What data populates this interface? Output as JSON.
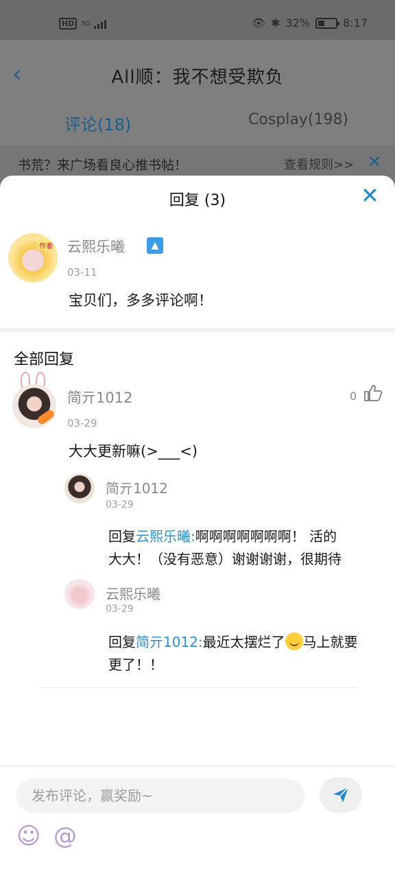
{
  "status_bar": {
    "hd": "HD",
    "network": "5G",
    "battery_percent": "32%",
    "time": "8:17"
  },
  "header": {
    "back_icon": "chevron-left-icon",
    "title": "All顺：我不想受欺负"
  },
  "tabs": [
    {
      "label": "评论(18)",
      "active": true
    },
    {
      "label": "Cosplay(198)",
      "active": false
    }
  ],
  "notice": {
    "text": "书荒？来广场看良心推书帖！",
    "link": "查看规则>>",
    "close_icon": "close-icon"
  },
  "sheet": {
    "title": "回复 (3)",
    "close_icon": "close-icon",
    "main_comment": {
      "author": "云熙乐曦",
      "author_badge": "作者",
      "date": "03-11",
      "text": "宝贝们，多多评论啊！",
      "pin_icon": "pin-top-icon"
    },
    "section_title": "全部回复",
    "reply": {
      "author": "简亓1012",
      "date": "03-29",
      "text": "大大更新嘛(>___<)",
      "like_count": "0",
      "sub_replies": [
        {
          "author": "简亓1012",
          "date": "03-29",
          "prefix": "回复",
          "mention": "云熙乐曦:",
          "line1_rest": "啊啊啊啊啊啊啊！ 活的",
          "line2": "大大！（没有恶意）谢谢谢谢，很期待"
        },
        {
          "author": "云熙乐曦",
          "date": "03-29",
          "prefix": "回复",
          "mention": "简亓1012:",
          "line1_rest": "最近太摆烂了",
          "line1_after_emoji": "马上就要",
          "line2": "更了！！",
          "emoji": "sleepy-face-emoji"
        }
      ]
    }
  },
  "composer": {
    "placeholder": "发布评论，赢奖励~",
    "send_icon": "send-icon",
    "emoji_icon": "smiley-icon",
    "mention_icon": "at-icon"
  },
  "colors": {
    "accent": "#1e88d6",
    "mention": "#2a8fd1",
    "overlay": "#7f7f7f"
  }
}
